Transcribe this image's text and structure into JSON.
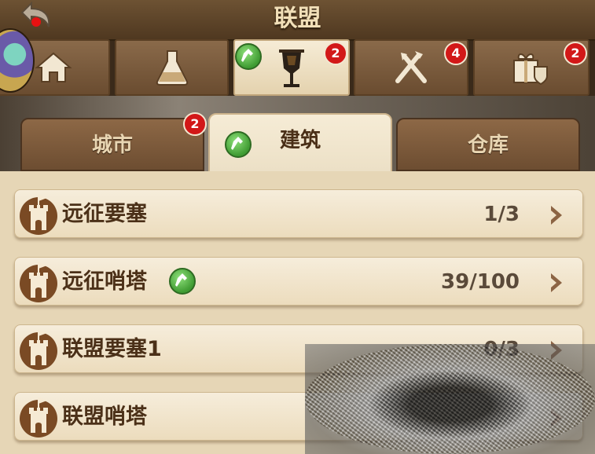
{
  "header": {
    "title": "联盟"
  },
  "top_tabs": [
    {
      "icon": "home-icon",
      "badge": ""
    },
    {
      "icon": "flask-icon",
      "badge": ""
    },
    {
      "icon": "banner-icon",
      "badge": "2",
      "active": true,
      "hammer": true
    },
    {
      "icon": "crossed-weapons-icon",
      "badge": "4"
    },
    {
      "icon": "gift-shield-icon",
      "badge": "2"
    }
  ],
  "sub_tabs": [
    {
      "label": "城市",
      "badge": "2"
    },
    {
      "label": "建筑",
      "active": true,
      "hammer": true
    },
    {
      "label": "仓库"
    }
  ],
  "buildings": [
    {
      "name": "远征要塞",
      "count": "1/3",
      "hammer": false
    },
    {
      "name": "远征哨塔",
      "count": "39/100",
      "hammer": true
    },
    {
      "name": "联盟要塞1",
      "count": "0/3",
      "hammer": false
    },
    {
      "name": "联盟哨塔",
      "count": "",
      "hammer": false
    }
  ],
  "colors": {
    "badge_red": "#d21818",
    "hammer_green": "#3f9b32",
    "text_brown": "#4b3018"
  }
}
